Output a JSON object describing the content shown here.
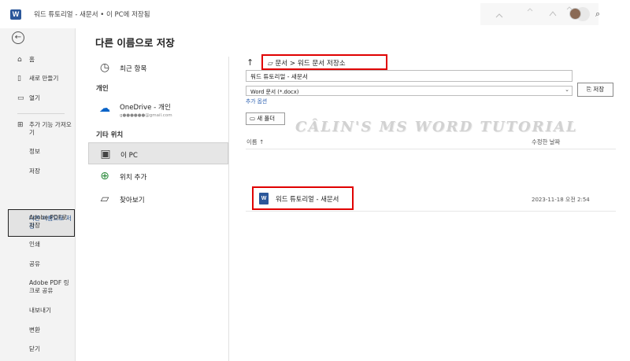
{
  "titlebar": {
    "app_icon": "word-icon",
    "title": "워드 튜토리얼 - 새문서 • 이 PC에 저장됨"
  },
  "sidebar": {
    "back_icon": "back-arrow-icon",
    "items": [
      {
        "label": "홈",
        "icon": "home-icon"
      },
      {
        "label": "새로 만들기",
        "icon": "new-document-icon"
      },
      {
        "label": "열기",
        "icon": "open-folder-icon"
      },
      {
        "label": "추가 기능 가져오기",
        "icon": "addins-icon"
      },
      {
        "label": "정보"
      },
      {
        "label": "저장"
      },
      {
        "label": "다른 이름으로 저장"
      },
      {
        "label": "Adobe PDF로 저장"
      },
      {
        "label": "인쇄"
      },
      {
        "label": "공유"
      },
      {
        "label": "Adobe PDF 링크로 공유"
      },
      {
        "label": "내보내기"
      },
      {
        "label": "변환"
      },
      {
        "label": "닫기"
      }
    ],
    "active_index": 6
  },
  "main": {
    "heading": "다른 이름으로 저장"
  },
  "locations": {
    "recent": "최근 항목",
    "personal_header": "개인",
    "onedrive": "OneDrive - 개인",
    "onedrive_account": "g●●●●●●@gmail.com",
    "other_header": "기타 위치",
    "this_pc": "이 PC",
    "add_place": "위치 추가",
    "browse": "찾아보기"
  },
  "save_pane": {
    "breadcrumb": "문서 > 워드 문서 저장소",
    "filename_value": "워드 튜토리얼 - 새문서",
    "filetype_value": "Word 문서 (*.docx)",
    "more_options": "추가 옵션",
    "save_label": "저장",
    "new_folder_label": "새 폴더",
    "watermark": "CÂLIN'S MS WORD TUTORIAL",
    "col_name": "이름",
    "col_modified": "수정한 날짜",
    "files": [
      {
        "name": "워드 튜토리얼 - 새문서",
        "modified": "2023-11-18 오전 2:54"
      }
    ]
  },
  "colors": {
    "accent": "#2b579a",
    "highlight_box": "#e00000",
    "link": "#2b5fb0"
  }
}
